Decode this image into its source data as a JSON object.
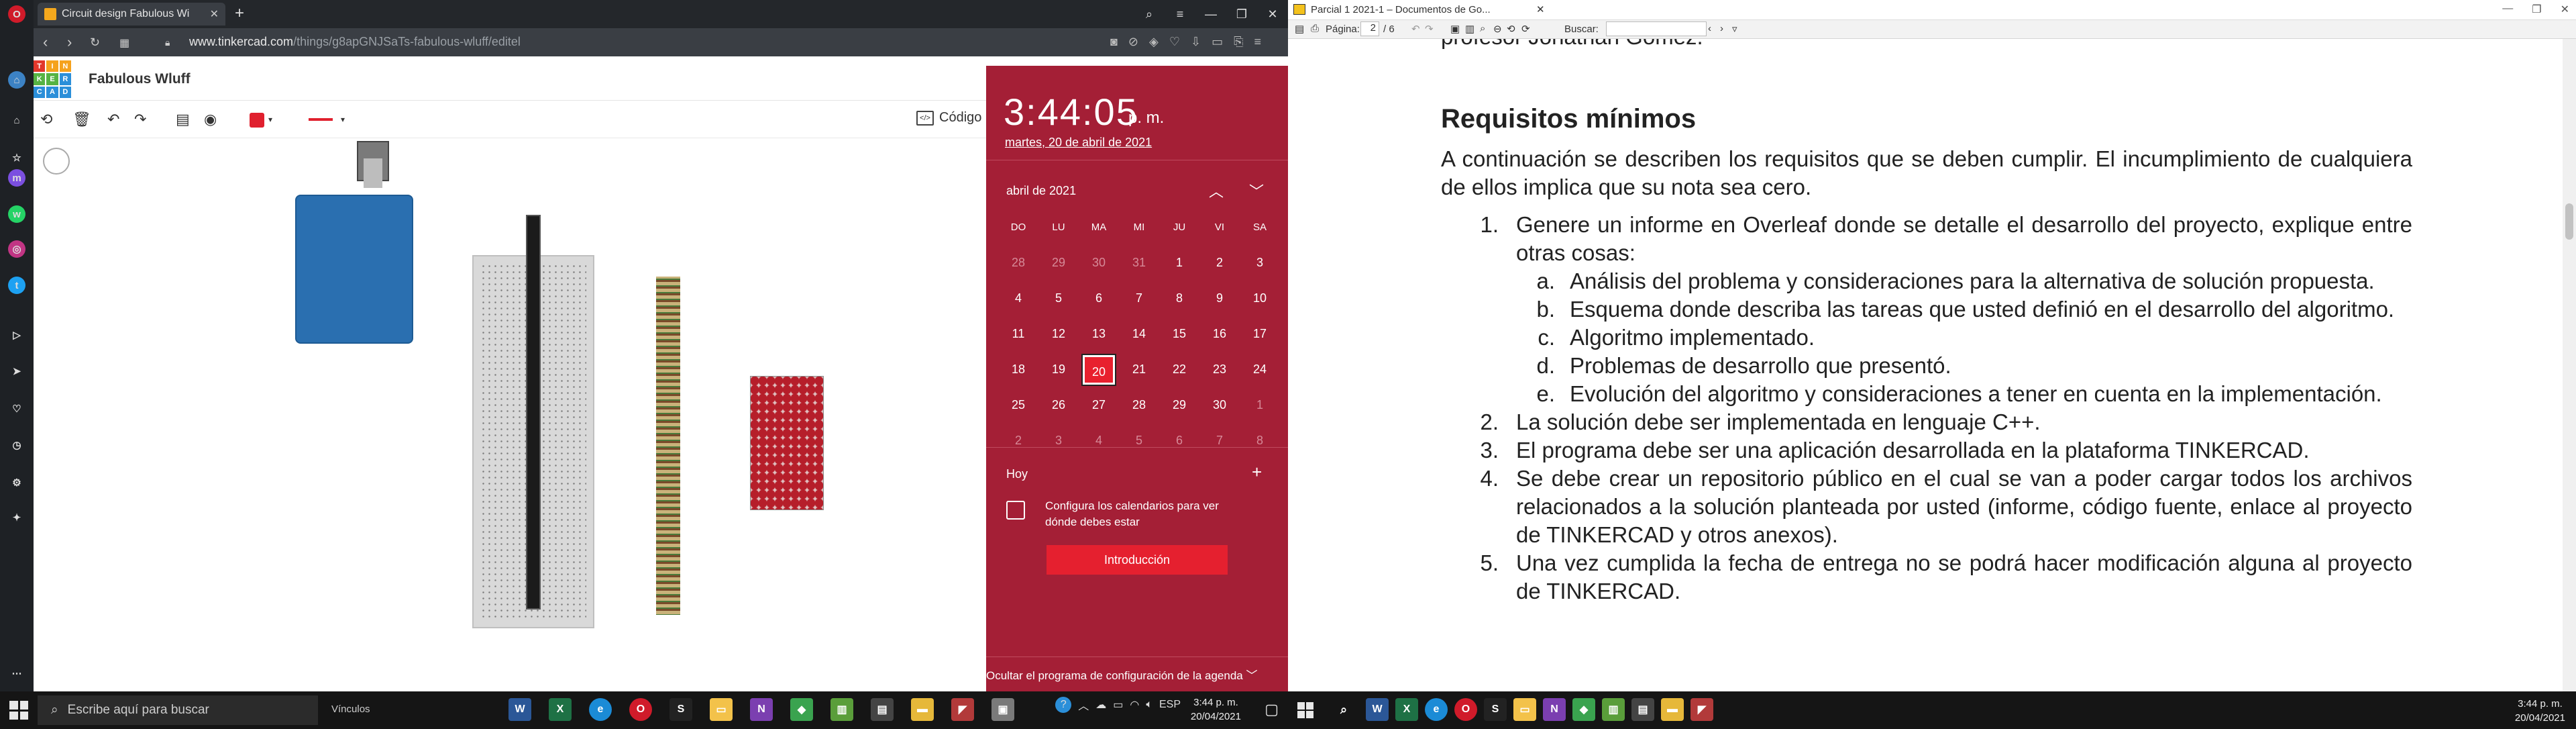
{
  "left": {
    "browser": {
      "tab_title": "Circuit design Fabulous Wi",
      "url_host": "www.tinkercad.com",
      "url_path": "/things/g8apGNJSaTs-fabulous-wluff/editel"
    },
    "tinkercad": {
      "logo_letters": [
        "TIN",
        "KER",
        "CAD"
      ],
      "project_title": "Fabulous Wluff",
      "code_label": "Código",
      "toolbar_color": "#e0202e"
    },
    "calendar": {
      "time": "3:44:05",
      "ampm": "p. m.",
      "date": "martes, 20 de abril de 2021",
      "month": "abril de 2021",
      "weekdays": [
        "DO",
        "LU",
        "MA",
        "MI",
        "JU",
        "VI",
        "SA"
      ],
      "weeks": [
        [
          "28",
          "29",
          "30",
          "31",
          "1",
          "2",
          "3"
        ],
        [
          "4",
          "5",
          "6",
          "7",
          "8",
          "9",
          "10"
        ],
        [
          "11",
          "12",
          "13",
          "14",
          "15",
          "16",
          "17"
        ],
        [
          "18",
          "19",
          "20",
          "21",
          "22",
          "23",
          "24"
        ],
        [
          "25",
          "26",
          "27",
          "28",
          "29",
          "30",
          "1"
        ],
        [
          "2",
          "3",
          "4",
          "5",
          "6",
          "7",
          "8"
        ]
      ],
      "today": "20",
      "agenda_label": "Hoy",
      "agenda_message": "Configura los calendarios para ver dónde debes estar",
      "intro_button": "Introducción",
      "hide_agenda": "Ocultar el programa de configuración de la agenda"
    },
    "taskbar": {
      "search_placeholder": "Escribe aquí para buscar",
      "links_label": "Vínculos",
      "lang": "ESP",
      "clock_time": "3:44 p. m.",
      "clock_date": "20/04/2021"
    }
  },
  "right": {
    "window_title": "Parcial 1 2021-1 – Documentos de Go...",
    "page_label": "Página:",
    "page_num": "2",
    "page_total": "/ 6",
    "search_label": "Buscar:",
    "doc": {
      "prev_line": "profesor Jonathan Gómez.",
      "heading": "Requisitos mínimos",
      "intro": "A continuación se describen los requisitos que se deben cumplir. El incumplimiento de cualquiera de ellos implica que su nota sea cero.",
      "items": [
        {
          "num": "1.",
          "text": "Genere un informe en Overleaf donde se detalle el desarrollo del proyecto, explique entre otras cosas:"
        },
        {
          "num": "2.",
          "text": "La solución debe ser implementada en lenguaje C++."
        },
        {
          "num": "3.",
          "text": "El programa debe ser una aplicación desarrollada en la plataforma TINKERCAD."
        },
        {
          "num": "4.",
          "text": "Se debe crear un repositorio público en el cual se van a poder cargar todos los archivos relacionados a la solución planteada por usted (informe, código fuente, enlace al proyecto de TINKERCAD y otros anexos)."
        },
        {
          "num": "5.",
          "text": "Una vez cumplida la fecha de entrega no se podrá hacer modificación alguna al proyecto de TINKERCAD."
        }
      ],
      "subitems": [
        {
          "num": "a.",
          "text": "Análisis del problema y consideraciones para la alternativa de solución propuesta."
        },
        {
          "num": "b.",
          "text": "Esquema donde describa las tareas que usted definió en el desarrollo del algoritmo."
        },
        {
          "num": "c.",
          "text": "Algoritmo implementado."
        },
        {
          "num": "d.",
          "text": "Problemas de desarrollo que presentó."
        },
        {
          "num": "e.",
          "text": "Evolución del algoritmo y consideraciones a tener en cuenta en la implementación."
        }
      ]
    },
    "clock_time": "3:44 p. m.",
    "clock_date": "20/04/2021"
  }
}
